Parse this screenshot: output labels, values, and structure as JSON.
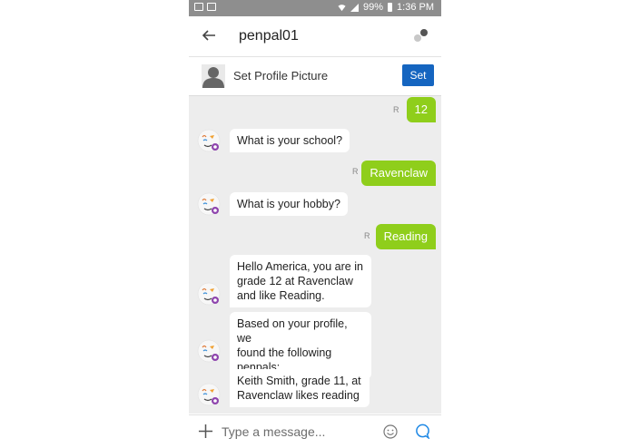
{
  "status_bar": {
    "battery": "99%",
    "time": "1:36 PM"
  },
  "header": {
    "title": "penpal01"
  },
  "profile_bar": {
    "label": "Set Profile Picture",
    "button": "Set"
  },
  "messages": [
    {
      "from": "user",
      "text": "12"
    },
    {
      "from": "bot",
      "text": "What is your school?"
    },
    {
      "from": "user",
      "text": "Ravenclaw"
    },
    {
      "from": "bot",
      "text": "What is your hobby?"
    },
    {
      "from": "user",
      "text": "Reading"
    },
    {
      "from": "bot",
      "lines": [
        "Hello America, you are in",
        "grade 12 at Ravenclaw",
        "and like Reading."
      ]
    },
    {
      "from": "bot",
      "lines": [
        "Based on your profile, we",
        "found the following",
        "penpals:"
      ]
    },
    {
      "from": "bot",
      "lines": [
        "Keith Smith, grade 11, at",
        "Ravenclaw likes reading"
      ]
    }
  ],
  "read_mark": "R",
  "composer": {
    "placeholder": "Type a message..."
  },
  "colors": {
    "user_bubble": "#8fce1b",
    "set_button": "#1565c0",
    "chat_background": "#ededed",
    "status_bar": "#8e8e8e"
  }
}
